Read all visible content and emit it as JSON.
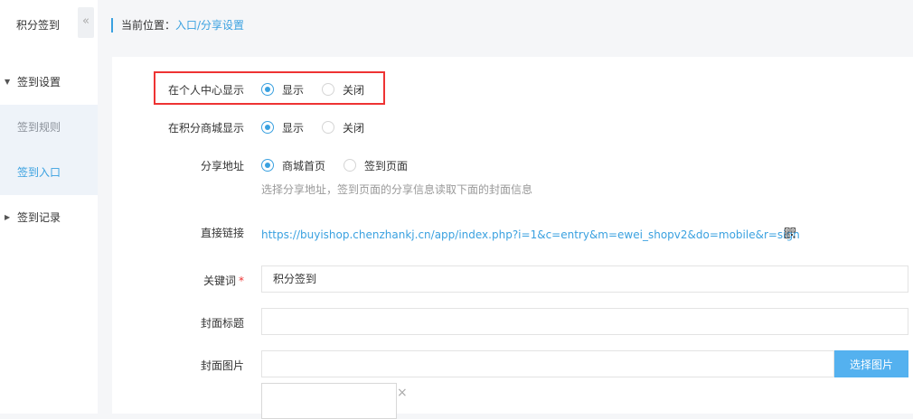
{
  "sidebar": {
    "title": "积分签到",
    "collapse_icon": "«",
    "groups": [
      {
        "label": "签到设置",
        "arrow": "▼"
      },
      {
        "label": "签到记录",
        "arrow": "▶"
      }
    ],
    "items": [
      {
        "label": "签到规则"
      },
      {
        "label": "签到入口",
        "active": true
      }
    ]
  },
  "breadcrumb": {
    "prefix": "当前位置：",
    "current": "入口/分享设置"
  },
  "form": {
    "personal_center": {
      "label": "在个人中心显示",
      "options": [
        "显示",
        "关闭"
      ],
      "selected": "显示"
    },
    "points_mall": {
      "label": "在积分商城显示",
      "options": [
        "显示",
        "关闭"
      ],
      "selected": "显示"
    },
    "share_address": {
      "label": "分享地址",
      "options": [
        "商城首页",
        "签到页面"
      ],
      "selected": "商城首页",
      "hint": "选择分享地址，签到页面的分享信息读取下面的封面信息"
    },
    "direct_link": {
      "label": "直接链接",
      "url": "https://buyishop.chenzhankj.cn/app/index.php?i=1&c=entry&m=ewei_shopv2&do=mobile&r=sign",
      "icon": "qrcode-icon"
    },
    "keyword": {
      "label": "关键词",
      "required_mark": "*",
      "value": "积分签到"
    },
    "cover_title": {
      "label": "封面标题",
      "value": ""
    },
    "cover_image": {
      "label": "封面图片",
      "value": "",
      "button_label": "选择图片",
      "remove_icon": "×"
    }
  },
  "colors": {
    "accent": "#3aa1e0",
    "highlight_border": "#e33333",
    "button": "#54b1ef"
  }
}
